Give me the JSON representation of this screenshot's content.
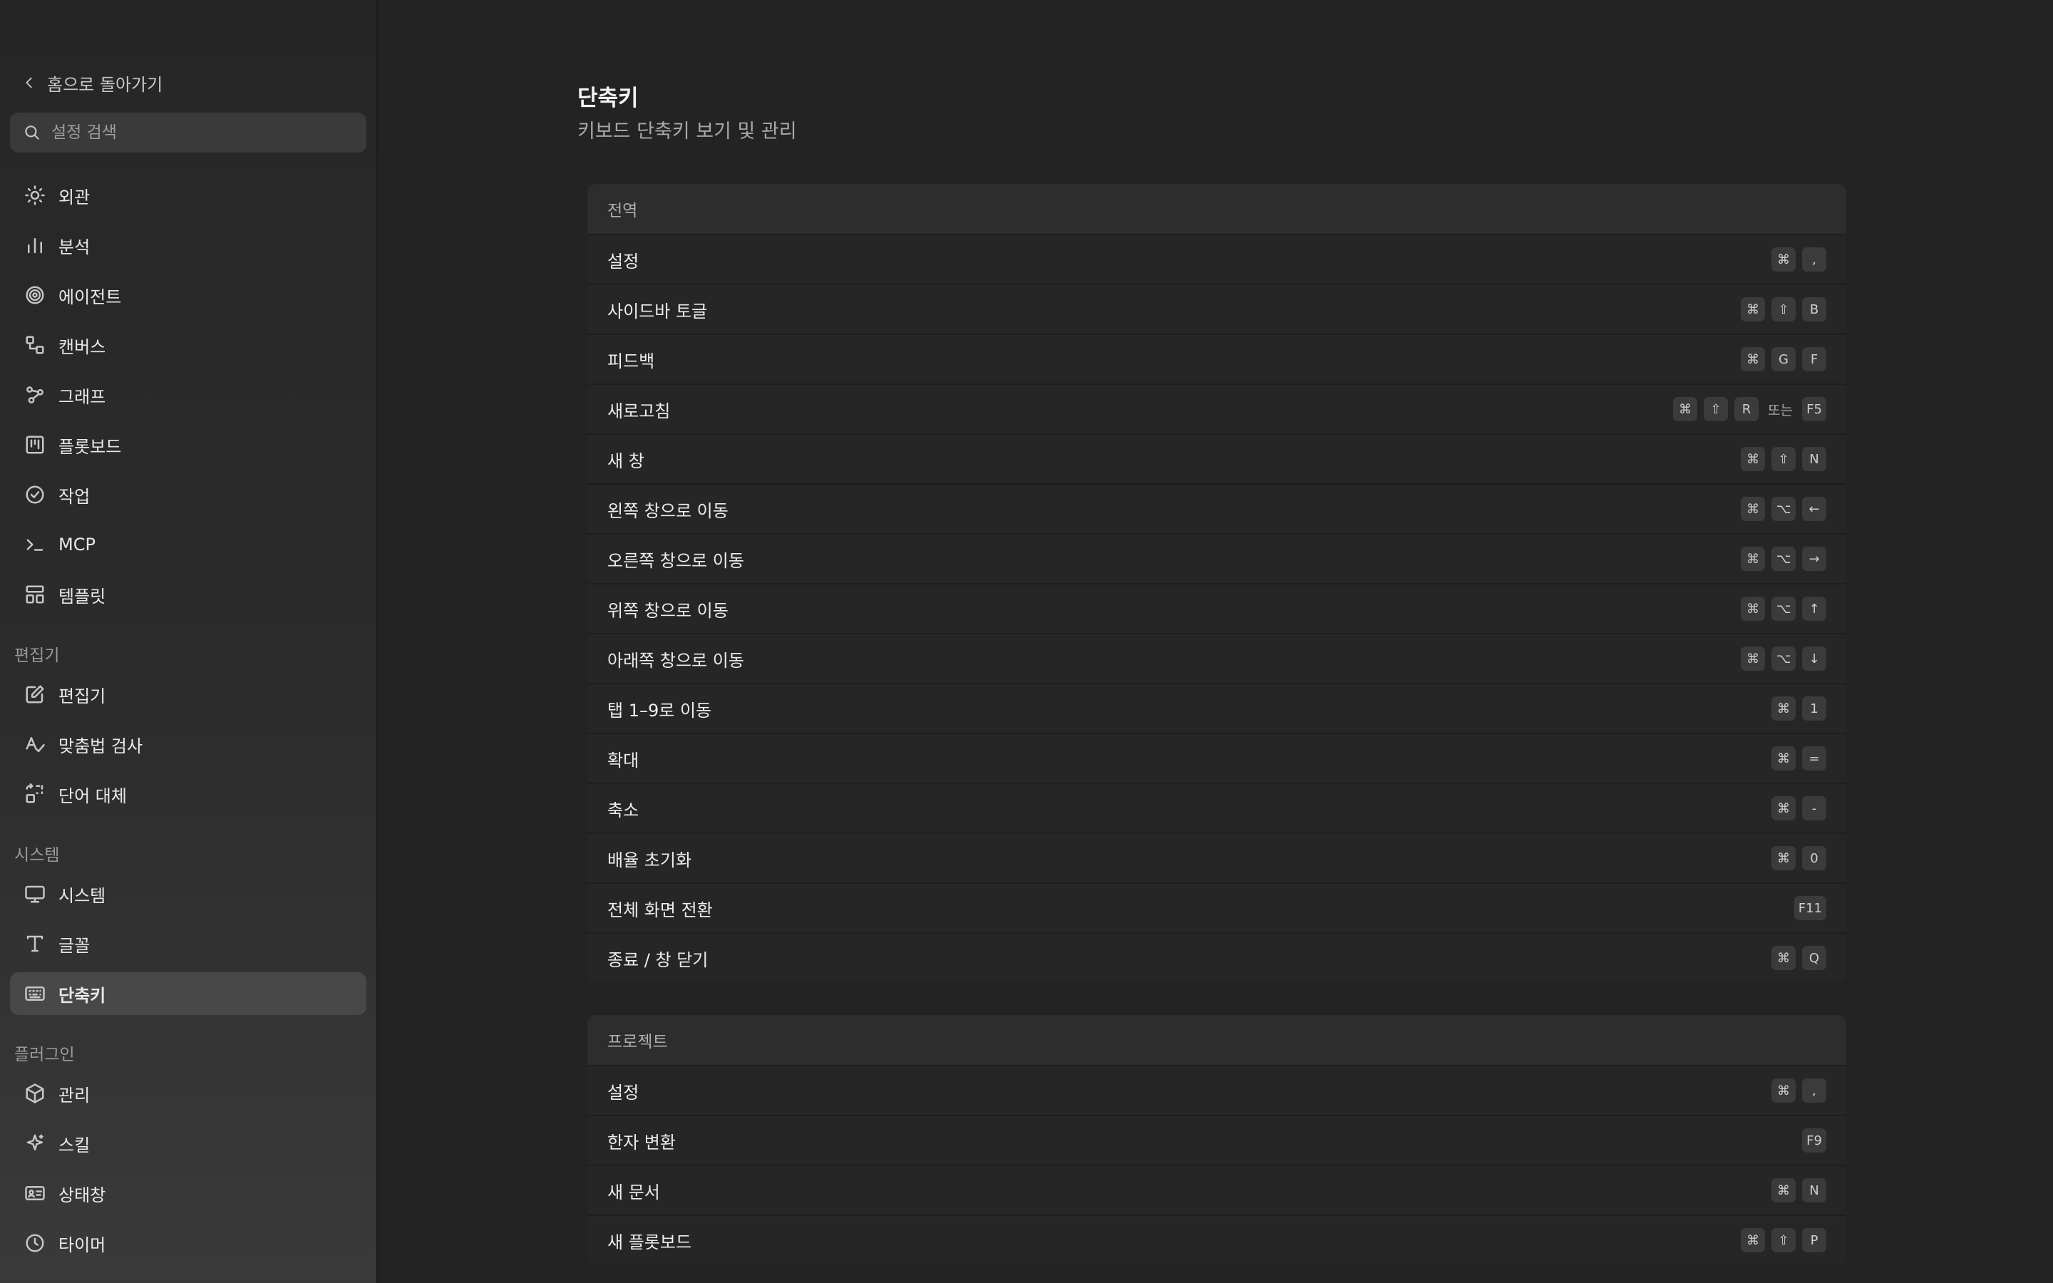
{
  "sidebar": {
    "back_label": "홈으로 돌아가기",
    "search_placeholder": "설정 검색",
    "items_top": [
      {
        "label": "외관",
        "icon": "sun-icon"
      },
      {
        "label": "분석",
        "icon": "bar-chart-icon"
      },
      {
        "label": "에이전트",
        "icon": "spiral-icon"
      },
      {
        "label": "캔버스",
        "icon": "shapes-icon"
      },
      {
        "label": "그래프",
        "icon": "graph-icon"
      },
      {
        "label": "플롯보드",
        "icon": "kanban-icon"
      },
      {
        "label": "작업",
        "icon": "check-circle-icon"
      },
      {
        "label": "MCP",
        "icon": "terminal-icon"
      },
      {
        "label": "템플릿",
        "icon": "layout-icon"
      }
    ],
    "editor_section": "편집기",
    "items_editor": [
      {
        "label": "편집기",
        "icon": "edit-icon"
      },
      {
        "label": "맞춤법 검사",
        "icon": "spellcheck-icon"
      },
      {
        "label": "단어 대체",
        "icon": "replace-icon"
      }
    ],
    "system_section": "시스템",
    "items_system": [
      {
        "label": "시스템",
        "icon": "monitor-icon"
      },
      {
        "label": "글꼴",
        "icon": "type-icon"
      },
      {
        "label": "단축키",
        "icon": "keyboard-icon",
        "active": true
      }
    ],
    "plugin_section": "플러그인",
    "items_plugin": [
      {
        "label": "관리",
        "icon": "package-icon"
      },
      {
        "label": "스킬",
        "icon": "sparkle-icon"
      },
      {
        "label": "상태창",
        "icon": "id-card-icon"
      },
      {
        "label": "타이머",
        "icon": "clock-icon"
      }
    ]
  },
  "main": {
    "title": "단축키",
    "subtitle": "키보드 단축키 보기 및 관리",
    "global_section": {
      "header": "전역",
      "rows": [
        {
          "label": "설정",
          "keys": [
            "⌘",
            ","
          ]
        },
        {
          "label": "사이드바 토글",
          "keys": [
            "⌘",
            "⇧",
            "B"
          ]
        },
        {
          "label": "피드백",
          "keys": [
            "⌘",
            "G",
            "F"
          ]
        },
        {
          "label": "새로고침",
          "keys": [
            "⌘",
            "⇧",
            "R"
          ],
          "or_text": "또는",
          "alt_keys": [
            "F5"
          ]
        },
        {
          "label": "새 창",
          "keys": [
            "⌘",
            "⇧",
            "N"
          ]
        },
        {
          "label": "왼쪽 창으로 이동",
          "keys": [
            "⌘",
            "⌥",
            "←"
          ]
        },
        {
          "label": "오른쪽 창으로 이동",
          "keys": [
            "⌘",
            "⌥",
            "→"
          ]
        },
        {
          "label": "위쪽 창으로 이동",
          "keys": [
            "⌘",
            "⌥",
            "↑"
          ]
        },
        {
          "label": "아래쪽 창으로 이동",
          "keys": [
            "⌘",
            "⌥",
            "↓"
          ]
        },
        {
          "label": "탭 1–9로 이동",
          "keys": [
            "⌘",
            "1"
          ]
        },
        {
          "label": "확대",
          "keys": [
            "⌘",
            "="
          ]
        },
        {
          "label": "축소",
          "keys": [
            "⌘",
            "-"
          ]
        },
        {
          "label": "배율 초기화",
          "keys": [
            "⌘",
            "0"
          ]
        },
        {
          "label": "전체 화면 전환",
          "keys": [
            "F11"
          ]
        },
        {
          "label": "종료 / 창 닫기",
          "keys": [
            "⌘",
            "Q"
          ]
        }
      ]
    },
    "project_section": {
      "header": "프로젝트",
      "rows": [
        {
          "label": "설정",
          "keys": [
            "⌘",
            ","
          ]
        },
        {
          "label": "한자 변환",
          "keys": [
            "F9"
          ]
        },
        {
          "label": "새 문서",
          "keys": [
            "⌘",
            "N"
          ]
        },
        {
          "label": "새 플롯보드",
          "keys": [
            "⌘",
            "⇧",
            "P"
          ]
        }
      ]
    }
  }
}
